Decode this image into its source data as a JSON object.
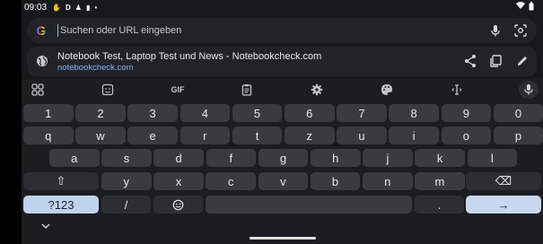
{
  "status": {
    "time": "09:03",
    "icons": [
      "hand-icon",
      "d-icon",
      "person-icon",
      "battery-small-icon",
      "dot-icon"
    ],
    "right_icons": [
      "wifi-icon",
      "battery-icon"
    ]
  },
  "omnibox": {
    "placeholder": "Suchen oder URL eingeben",
    "value": ""
  },
  "suggestion": {
    "title": "Notebook Test, Laptop Test und News - Notebookcheck.com",
    "url": "notebookcheck.com"
  },
  "toolbar": {
    "gif_label": "GIF"
  },
  "keyboard": {
    "row_numbers": [
      "1",
      "2",
      "3",
      "4",
      "5",
      "6",
      "7",
      "8",
      "9",
      "0"
    ],
    "row1": [
      "q",
      "w",
      "e",
      "r",
      "t",
      "z",
      "u",
      "i",
      "o",
      "p"
    ],
    "row2": [
      "a",
      "s",
      "d",
      "f",
      "g",
      "h",
      "j",
      "k",
      "l"
    ],
    "row3": [
      "y",
      "x",
      "c",
      "v",
      "b",
      "n",
      "m"
    ],
    "symbols_label": "?123",
    "slash_label": "/",
    "period_label": ".",
    "enter_label": "→",
    "shift_label": "⇧",
    "backspace_label": "⌫"
  },
  "colors": {
    "accent": "#8ab4f8",
    "key": "#3a3b40",
    "background": "#17191d"
  }
}
